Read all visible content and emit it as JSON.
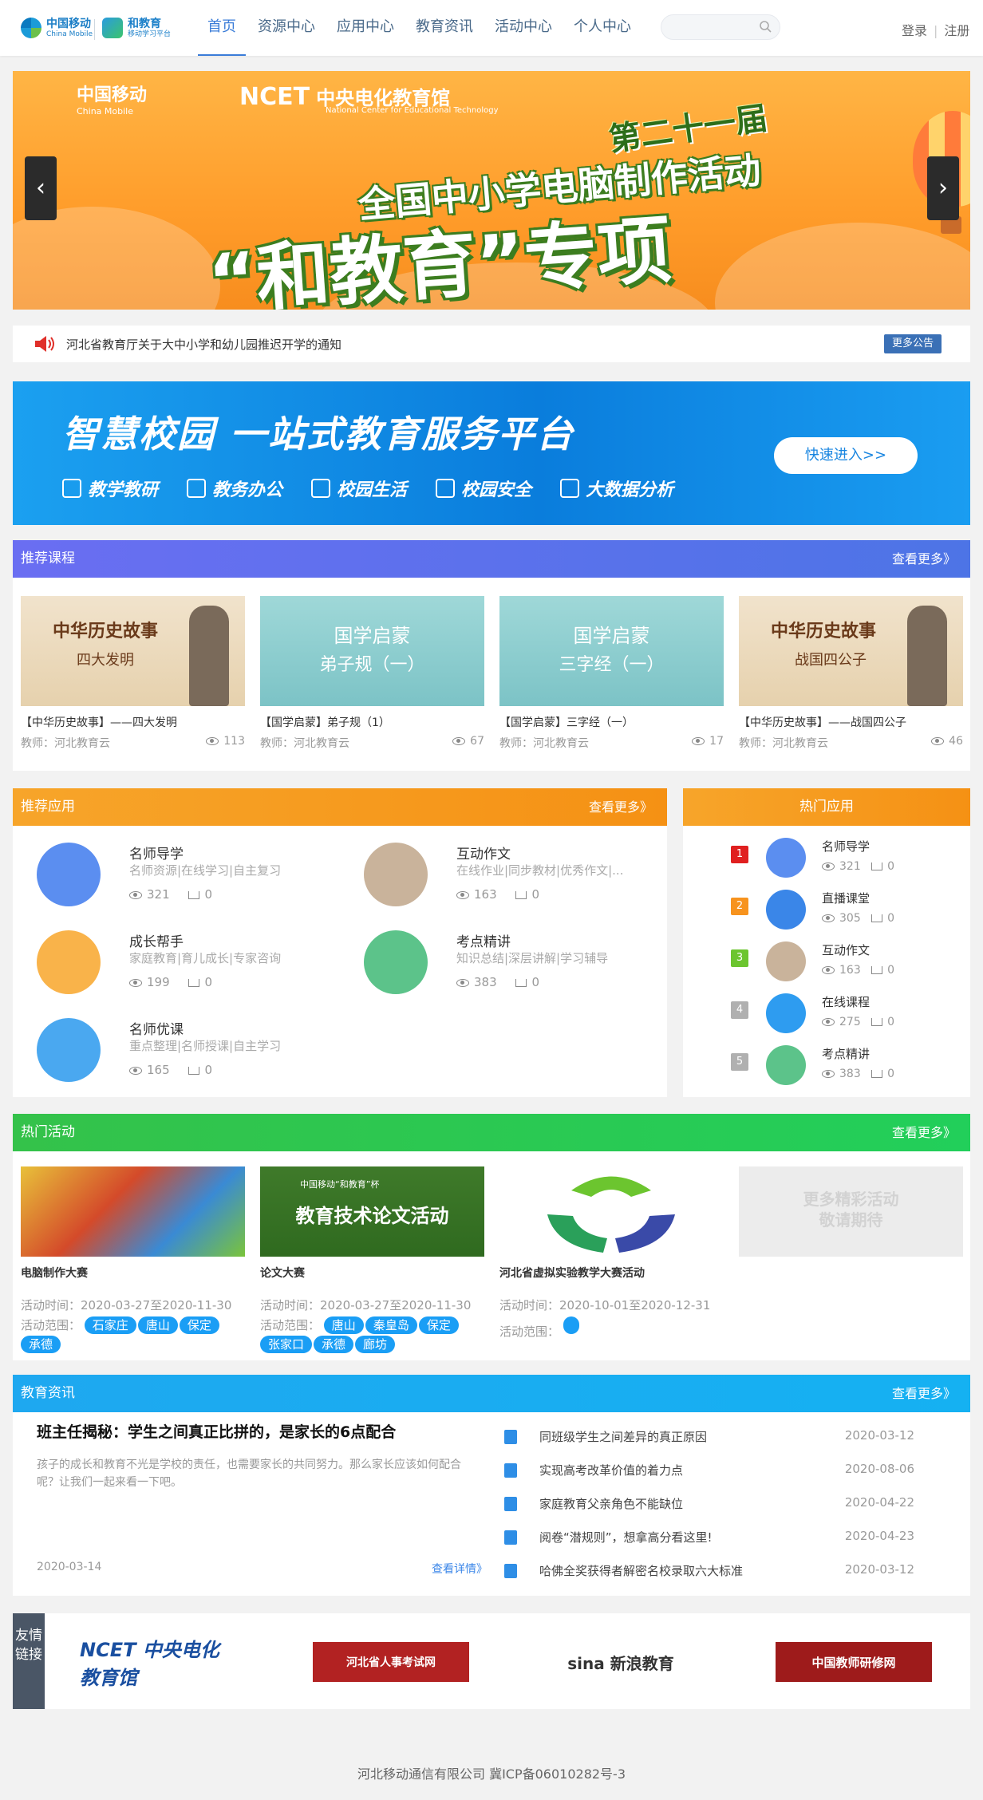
{
  "header": {
    "logo1_main": "中国移动",
    "logo1_sub": "China Mobile",
    "logo2_main": "和教育",
    "logo2_sub": "移动学习平台",
    "nav": [
      "首页",
      "资源中心",
      "应用中心",
      "教育资讯",
      "活动中心",
      "个人中心"
    ],
    "search_placeholder": "",
    "login": "登录",
    "register": "注册",
    "accent": "#3a7cd8"
  },
  "banner": {
    "logo_main": "中国移动",
    "logo_sub": "China Mobile",
    "ncet": "NCET",
    "ncet_cn": "中央电化教育馆",
    "ncet_en": "National Center for Educational Technology",
    "line1": "第二十一届",
    "line2": "全国中小学电脑制作活动",
    "line3": "“和教育”专项",
    "prev": "‹",
    "next": "›"
  },
  "notice": {
    "text": "河北省教育厅关于大中小学和幼儿园推迟开学的通知",
    "more": "更多公告"
  },
  "smart": {
    "title": "智慧校园  一站式教育服务平台",
    "features": [
      "教学教研",
      "教务办公",
      "校园生活",
      "校园安全",
      "大数据分析"
    ],
    "button": "快速进入>>"
  },
  "courses": {
    "header": "推荐课程",
    "more": "查看更多》",
    "items": [
      {
        "img_title": "中华历史故事",
        "img_sub": "四大发明",
        "title": "【中华历史故事】——四大发明",
        "teacher": "教师：河北教育云",
        "views": "113"
      },
      {
        "img_title": "国学启蒙",
        "img_sub": "弟子规（一）",
        "title": "【国学启蒙】弟子规（1）",
        "teacher": "教师：河北教育云",
        "views": "67"
      },
      {
        "img_title": "国学启蒙",
        "img_sub": "三字经（一）",
        "title": "【国学启蒙】三字经（一）",
        "teacher": "教师：河北教育云",
        "views": "17"
      },
      {
        "img_title": "中华历史故事",
        "img_sub": "战国四公子",
        "title": "【中华历史故事】——战国四公子",
        "teacher": "教师：河北教育云",
        "views": "46"
      }
    ]
  },
  "apps": {
    "header": "推荐应用",
    "more": "查看更多》",
    "items": [
      {
        "name": "名师导学",
        "desc": "名师资源|在线学习|自主复习",
        "views": "321",
        "carts": "0",
        "color": "#5b8ef0"
      },
      {
        "name": "互动作文",
        "desc": "在线作业|同步教材|优秀作文|...",
        "views": "163",
        "carts": "0",
        "color": "#c9b39b"
      },
      {
        "name": "成长帮手",
        "desc": "家庭教育|育儿成长|专家咨询",
        "views": "199",
        "carts": "0",
        "color": "#f9b34a"
      },
      {
        "name": "考点精讲",
        "desc": "知识总结|深层讲解|学习辅导",
        "views": "383",
        "carts": "0",
        "color": "#5cc38a"
      },
      {
        "name": "名师优课",
        "desc": "重点整理|名师授课|自主学习",
        "views": "165",
        "carts": "0",
        "color": "#4aa8f0"
      }
    ]
  },
  "hot_apps": {
    "header": "热门应用",
    "items": [
      {
        "rank": "1",
        "name": "名师导学",
        "views": "321",
        "carts": "0",
        "rank_color": "#e02020",
        "color": "#5b8ef0"
      },
      {
        "rank": "2",
        "name": "直播课堂",
        "views": "305",
        "carts": "0",
        "rank_color": "#f7931e",
        "color": "#3a86e8"
      },
      {
        "rank": "3",
        "name": "互动作文",
        "views": "163",
        "carts": "0",
        "rank_color": "#6cc52f",
        "color": "#c9b39b"
      },
      {
        "rank": "4",
        "name": "在线课程",
        "views": "275",
        "carts": "0",
        "rank_color": "#b0b0b0",
        "color": "#2e9cf0"
      },
      {
        "rank": "5",
        "name": "考点精讲",
        "views": "383",
        "carts": "0",
        "rank_color": "#b0b0b0",
        "color": "#5cc38a"
      }
    ]
  },
  "activities": {
    "header": "热门活动",
    "more": "查看更多》",
    "time_label": "活动时间：",
    "range_label": "活动范围：",
    "items": [
      {
        "name": "电脑制作大赛",
        "time": "2020-03-27至2020-11-30",
        "tags": [
          "石家庄",
          "唐山",
          "保定",
          "承德"
        ]
      },
      {
        "name": "论文大赛",
        "time": "2020-03-27至2020-11-30",
        "tags": [
          "唐山",
          "秦皇岛",
          "保定",
          "张家口",
          "承德",
          "廊坊"
        ],
        "img_title": "教育技术论文活动",
        "img_sub": "中国移动“和教育”杯"
      },
      {
        "name": "河北省虚拟实验教学大赛活动",
        "time": "2020-10-01至2020-12-31",
        "tags": [
          ""
        ]
      }
    ],
    "placeholder_line1": "更多精彩活动",
    "placeholder_line2": "敬请期待"
  },
  "news": {
    "header": "教育资讯",
    "more": "查看更多》",
    "main_title": "班主任揭秘：学生之间真正比拼的，是家长的6点配合",
    "main_desc": "孩子的成长和教育不光是学校的责任，也需要家长的共同努力。那么家长应该如何配合呢？让我们一起来看一下吧。",
    "main_date": "2020-03-14",
    "main_more": "查看详情》",
    "list": [
      {
        "title": "同班级学生之间差异的真正原因",
        "date": "2020-03-12"
      },
      {
        "title": "实现高考改革价值的着力点",
        "date": "2020-08-06"
      },
      {
        "title": "家庭教育父亲角色不能缺位",
        "date": "2020-04-22"
      },
      {
        "title": "阅卷“潜规则”，想拿高分看这里!",
        "date": "2020-04-23"
      },
      {
        "title": "哈佛全奖获得者解密名校录取六大标准",
        "date": "2020-03-12"
      }
    ]
  },
  "links": {
    "label": "友情链接",
    "items": [
      {
        "name": "NCET 中央电化教育馆",
        "color": "#1a4fa0"
      },
      {
        "name": "河北省人事考试网",
        "color": "#b22222"
      },
      {
        "name": "sina 新浪教育",
        "color": "#333333"
      },
      {
        "name": "中国教师研修网",
        "color": "#9e1b1b"
      }
    ]
  },
  "footer": {
    "text": "河北移动通信有限公司    冀ICP备06010282号-3"
  }
}
